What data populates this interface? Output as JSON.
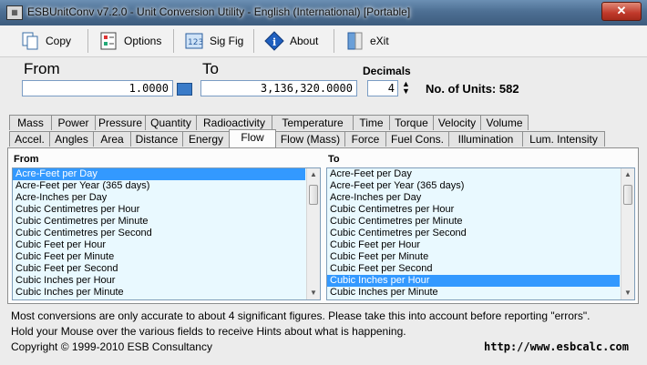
{
  "window": {
    "title": "ESBUnitConv v7.2.0 - Unit Conversion Utility - English (International) [Portable]",
    "close_label": "✕"
  },
  "toolbar": {
    "copy": "Copy",
    "options": "Options",
    "sigfig": "Sig Fig",
    "about": "About",
    "exit": "eXit"
  },
  "converter": {
    "from_label": "From",
    "to_label": "To",
    "decimals_label": "Decimals",
    "from_value": "1.0000",
    "to_value": "3,136,320.0000",
    "decimals_value": "4",
    "units_label": "No. of Units: 582"
  },
  "tabs_row1": [
    "Mass",
    "Power",
    "Pressure",
    "Quantity",
    "Radioactivity",
    "Temperature",
    "Time",
    "Torque",
    "Velocity",
    "Volume"
  ],
  "tabs_row2": [
    "Accel.",
    "Angles",
    "Area",
    "Distance",
    "Energy",
    "Flow",
    "Flow (Mass)",
    "Force",
    "Fuel Cons.",
    "Illumination",
    "Lum. Intensity"
  ],
  "active_tab": "Flow",
  "from_list": {
    "label": "From",
    "items": [
      "Acre-Feet per Day",
      "Acre-Feet per Year (365 days)",
      "Acre-Inches per Day",
      "Cubic Centimetres per Hour",
      "Cubic Centimetres per Minute",
      "Cubic Centimetres per Second",
      "Cubic Feet per Hour",
      "Cubic Feet per Minute",
      "Cubic Feet per Second",
      "Cubic Inches per Hour",
      "Cubic Inches per Minute"
    ],
    "selected": 0
  },
  "to_list": {
    "label": "To",
    "items": [
      "Acre-Feet per Day",
      "Acre-Feet per Year (365 days)",
      "Acre-Inches per Day",
      "Cubic Centimetres per Hour",
      "Cubic Centimetres per Minute",
      "Cubic Centimetres per Second",
      "Cubic Feet per Hour",
      "Cubic Feet per Minute",
      "Cubic Feet per Second",
      "Cubic Inches per Hour",
      "Cubic Inches per Minute"
    ],
    "selected": 9
  },
  "status": {
    "line1": "Most conversions are only accurate to about 4 significant figures. Please take this into account before reporting \"errors\".",
    "line2": "Hold your Mouse over the various fields to receive Hints about what is happening.",
    "copyright": "Copyright © 1999-2010 ESB Consultancy",
    "url": "http://www.esbcalc.com"
  },
  "colors": {
    "selection": "#3399ff",
    "list_bg": "#e9f9ff",
    "field_border": "#7a9cc4"
  }
}
